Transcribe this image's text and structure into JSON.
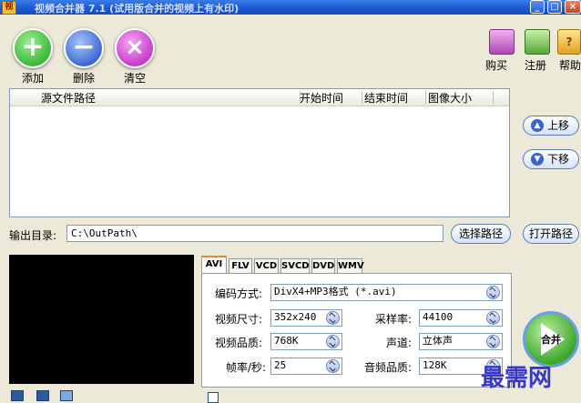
{
  "window": {
    "title": "视频合并器 7.1 (试用版合并的视频上有水印)"
  },
  "toolbar": {
    "add_label": "添加",
    "delete_label": "删除",
    "clear_label": "清空",
    "buy_label": "购买",
    "register_label": "注册",
    "help_label": "帮助"
  },
  "file_list": {
    "columns": [
      "源文件路径",
      "开始时间",
      "结束时间",
      "图像大小"
    ],
    "rows": []
  },
  "side_buttons": {
    "move_up": "上移",
    "move_down": "下移"
  },
  "output": {
    "label": "输出目录:",
    "path": "C:\\OutPath\\",
    "choose_path": "选择路径",
    "open_path": "打开路径"
  },
  "tabs": [
    "AVI",
    "FLV",
    "VCD",
    "SVCD",
    "DVD",
    "WMV"
  ],
  "active_tab": "AVI",
  "settings": {
    "codec_label": "编码方式:",
    "codec_value": "DivX4+MP3格式 (*.avi)",
    "size_label": "视频尺寸:",
    "size_value": "352x240",
    "quality_label": "视频品质:",
    "quality_value": "768K",
    "fps_label": "帧率/秒:",
    "fps_value": "25",
    "samplerate_label": "采样率:",
    "samplerate_value": "44100",
    "channel_label": "声道:",
    "channel_value": "立体声",
    "audio_quality_label": "音频品质:",
    "audio_quality_value": "128K"
  },
  "merge_button": {
    "label": "合并"
  },
  "watermark": "最需网",
  "colors": {
    "titlebar": "#2060d8",
    "window_bg": "#ece9d8",
    "add": "#3cb83c",
    "delete": "#3c6ad0",
    "clear": "#c83cc8",
    "merge": "#3ea62e",
    "watermark": "#3838c8"
  },
  "icons": [
    "add-icon",
    "delete-icon",
    "clear-icon",
    "buy-icon",
    "register-icon",
    "help-icon",
    "up-arrow-icon",
    "down-arrow-icon",
    "play-icon"
  ]
}
